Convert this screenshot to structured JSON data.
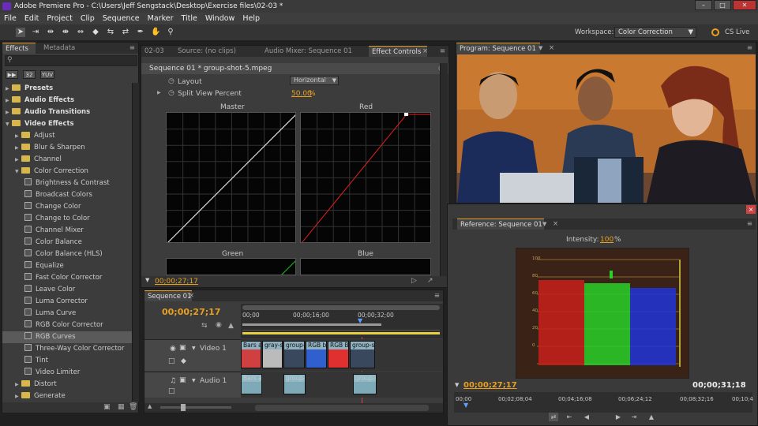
{
  "window": {
    "title": "Adobe Premiere Pro - C:\\Users\\Jeff Sengstack\\Desktop\\Exercise files\\02-03 *"
  },
  "menu": [
    "File",
    "Edit",
    "Project",
    "Clip",
    "Sequence",
    "Marker",
    "Title",
    "Window",
    "Help"
  ],
  "workspace": {
    "label": "Workspace:",
    "value": "Color Correction",
    "cs_live": "CS Live"
  },
  "effects_panel": {
    "tabs": [
      "Effects",
      "Metadata"
    ],
    "preset_buttons": [
      "32",
      "YUV"
    ],
    "items": [
      {
        "label": "Presets",
        "type": "folder",
        "level": 0,
        "bold": true
      },
      {
        "label": "Audio Effects",
        "type": "folder",
        "level": 0,
        "bold": true
      },
      {
        "label": "Audio Transitions",
        "type": "folder",
        "level": 0,
        "bold": true
      },
      {
        "label": "Video Effects",
        "type": "folder",
        "level": 0,
        "bold": true,
        "open": true
      },
      {
        "label": "Adjust",
        "type": "folder",
        "level": 1
      },
      {
        "label": "Blur & Sharpen",
        "type": "folder",
        "level": 1
      },
      {
        "label": "Channel",
        "type": "folder",
        "level": 1
      },
      {
        "label": "Color Correction",
        "type": "folder",
        "level": 1,
        "open": true
      },
      {
        "label": "Brightness & Contrast",
        "type": "fx",
        "level": 2
      },
      {
        "label": "Broadcast Colors",
        "type": "fx",
        "level": 2
      },
      {
        "label": "Change Color",
        "type": "fx",
        "level": 2
      },
      {
        "label": "Change to Color",
        "type": "fx",
        "level": 2
      },
      {
        "label": "Channel Mixer",
        "type": "fx",
        "level": 2
      },
      {
        "label": "Color Balance",
        "type": "fx",
        "level": 2
      },
      {
        "label": "Color Balance (HLS)",
        "type": "fx",
        "level": 2
      },
      {
        "label": "Equalize",
        "type": "fx",
        "level": 2
      },
      {
        "label": "Fast Color Corrector",
        "type": "fx",
        "level": 2
      },
      {
        "label": "Leave Color",
        "type": "fx",
        "level": 2
      },
      {
        "label": "Luma Corrector",
        "type": "fx",
        "level": 2
      },
      {
        "label": "Luma Curve",
        "type": "fx",
        "level": 2
      },
      {
        "label": "RGB Color Corrector",
        "type": "fx",
        "level": 2
      },
      {
        "label": "RGB Curves",
        "type": "fx",
        "level": 2,
        "selected": true
      },
      {
        "label": "Three-Way Color Corrector",
        "type": "fx",
        "level": 2
      },
      {
        "label": "Tint",
        "type": "fx",
        "level": 2
      },
      {
        "label": "Video Limiter",
        "type": "fx",
        "level": 2
      },
      {
        "label": "Distort",
        "type": "folder",
        "level": 1
      },
      {
        "label": "Generate",
        "type": "folder",
        "level": 1
      }
    ]
  },
  "effect_controls": {
    "tabs": [
      "02-03",
      "Source: (no clips)",
      "Audio Mixer: Sequence 01",
      "Effect Controls"
    ],
    "header": "Sequence 01 * group-shot-5.mpeg",
    "layout_label": "Layout",
    "layout_value": "Horizontal",
    "split_label": "Split View Percent",
    "split_value": "50.00",
    "split_unit": "%",
    "curves": [
      "Master",
      "Red",
      "Green",
      "Blue"
    ],
    "timecode": "00;00;27;17"
  },
  "program_monitor": {
    "tab": "Program: Sequence 01"
  },
  "reference_monitor": {
    "tab": "Reference: Sequence 01",
    "intensity_label": "Intensity:",
    "intensity_value": "100",
    "intensity_unit": "%",
    "scale": [
      "100",
      "80",
      "60",
      "40",
      "20",
      "0"
    ],
    "timecode": "00;00;27;17",
    "duration": "00;00;31;18",
    "ruler": [
      "00;00",
      "00;02;08;04",
      "00;04;16;08",
      "00;06;24;12",
      "00;08;32;16",
      "00;10;4"
    ]
  },
  "timeline": {
    "tab": "Sequence 01",
    "timecode": "00;00;27;17",
    "ruler": [
      "00;00",
      "00;00;16;00",
      "00;00;32;00"
    ],
    "video_track": "Video 1",
    "audio_track": "Audio 1",
    "video_clips": [
      "Bars a",
      "gray-s",
      "group-",
      "RGB b",
      "RGB B",
      "group-s"
    ],
    "audio_clips": [
      "Bars a",
      "group-",
      "group-s"
    ]
  }
}
